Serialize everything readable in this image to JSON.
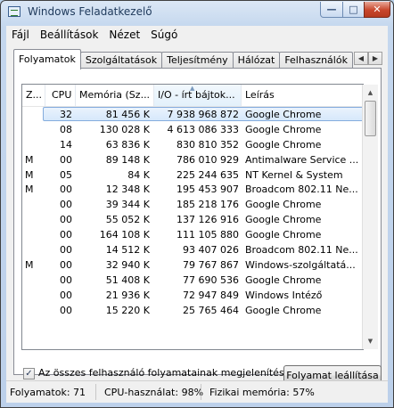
{
  "window": {
    "title": "Windows Feladatkezelő"
  },
  "controls": {
    "minimize": "—",
    "maximize": "□",
    "close": "✕"
  },
  "menu": [
    "Fájl",
    "Beállítások",
    "Nézet",
    "Súgó"
  ],
  "tabs": [
    "Folyamatok",
    "Szolgáltatások",
    "Teljesítmény",
    "Hálózat",
    "Felhasználók"
  ],
  "tab_scroll": {
    "left": "◀",
    "right": "▶"
  },
  "columns": [
    "Z...",
    "CPU",
    "Memória (Sz...",
    "I/O - írt bájtok...",
    "Leírás"
  ],
  "sort_indicator": "▲",
  "processes": [
    {
      "z": "",
      "cpu": "32",
      "mem": "81 456 K",
      "io": "7 938 968 872",
      "desc": "Google Chrome",
      "selected": true
    },
    {
      "z": "",
      "cpu": "08",
      "mem": "130 028 K",
      "io": "4 613 086 333",
      "desc": "Google Chrome"
    },
    {
      "z": "",
      "cpu": "14",
      "mem": "63 836 K",
      "io": "830 810 352",
      "desc": "Google Chrome"
    },
    {
      "z": "M",
      "cpu": "00",
      "mem": "89 148 K",
      "io": "786 010 929",
      "desc": "Antimalware Service ..."
    },
    {
      "z": "M",
      "cpu": "05",
      "mem": "84 K",
      "io": "225 244 635",
      "desc": "NT Kernel & System"
    },
    {
      "z": "M",
      "cpu": "00",
      "mem": "12 348 K",
      "io": "195 453 907",
      "desc": "Broadcom 802.11 Ne..."
    },
    {
      "z": "",
      "cpu": "00",
      "mem": "39 344 K",
      "io": "185 218 176",
      "desc": "Google Chrome"
    },
    {
      "z": "",
      "cpu": "00",
      "mem": "55 052 K",
      "io": "137 126 916",
      "desc": "Google Chrome"
    },
    {
      "z": "",
      "cpu": "00",
      "mem": "164 108 K",
      "io": "111 105 880",
      "desc": "Google Chrome"
    },
    {
      "z": "",
      "cpu": "00",
      "mem": "14 512 K",
      "io": "93 407 026",
      "desc": "Broadcom 802.11 Ne..."
    },
    {
      "z": "M",
      "cpu": "00",
      "mem": "32 940 K",
      "io": "79 767 867",
      "desc": "Windows-szolgáltatá..."
    },
    {
      "z": "",
      "cpu": "00",
      "mem": "51 408 K",
      "io": "77 690 536",
      "desc": "Google Chrome"
    },
    {
      "z": "",
      "cpu": "00",
      "mem": "21 936 K",
      "io": "72 947 849",
      "desc": "Windows Intéző"
    },
    {
      "z": "",
      "cpu": "00",
      "mem": "15 220 K",
      "io": "25 765 464",
      "desc": "Google Chrome"
    }
  ],
  "scrollbar": {
    "up": "▲",
    "down": "▼"
  },
  "show_all": {
    "label": "Az összes felhasználó folyamatainak megjelenítése",
    "checked": true,
    "mark": "✓"
  },
  "end_process_button": "Folyamat leállítása",
  "status": {
    "processes": "Folyamatok: 71",
    "cpu": "CPU-használat: 98%",
    "memory": "Fizikai memória: 57%"
  }
}
